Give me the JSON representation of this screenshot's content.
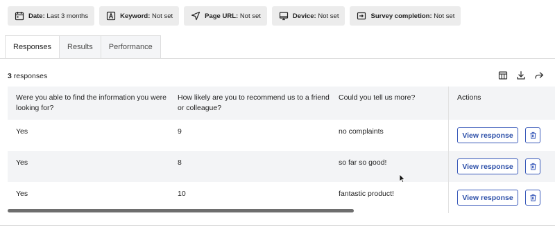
{
  "filters": [
    {
      "icon": "calendar-icon",
      "key": "Date:",
      "value": "Last 3 months"
    },
    {
      "icon": "keyword-icon",
      "key": "Keyword:",
      "value": "Not set"
    },
    {
      "icon": "navigation-arrow-icon",
      "key": "Page URL:",
      "value": "Not set"
    },
    {
      "icon": "monitor-icon",
      "key": "Device:",
      "value": "Not set"
    },
    {
      "icon": "survey-icon",
      "key": "Survey completion:",
      "value": "Not set"
    }
  ],
  "tabs": [
    {
      "label": "Responses",
      "active": true
    },
    {
      "label": "Results",
      "active": false
    },
    {
      "label": "Performance",
      "active": false
    }
  ],
  "summary": {
    "count": "3",
    "label": " responses"
  },
  "toolbar": {
    "icons": [
      "columns-icon",
      "download-icon",
      "share-icon"
    ]
  },
  "table": {
    "columns": [
      "Were you able to find the information you were looking for?",
      "How likely are you to recommend us to a friend or colleague?",
      "Could you tell us more?",
      "Actions"
    ],
    "rows": [
      {
        "found": "Yes",
        "score": "9",
        "comment": "no complaints"
      },
      {
        "found": "Yes",
        "score": "8",
        "comment": "so far so good!"
      },
      {
        "found": "Yes",
        "score": "10",
        "comment": "fantastic product!"
      }
    ],
    "view_label": "View response"
  },
  "colors": {
    "accent": "#3556b8",
    "header_bg": "#f3f4f6",
    "chip_bg": "#ececec"
  }
}
